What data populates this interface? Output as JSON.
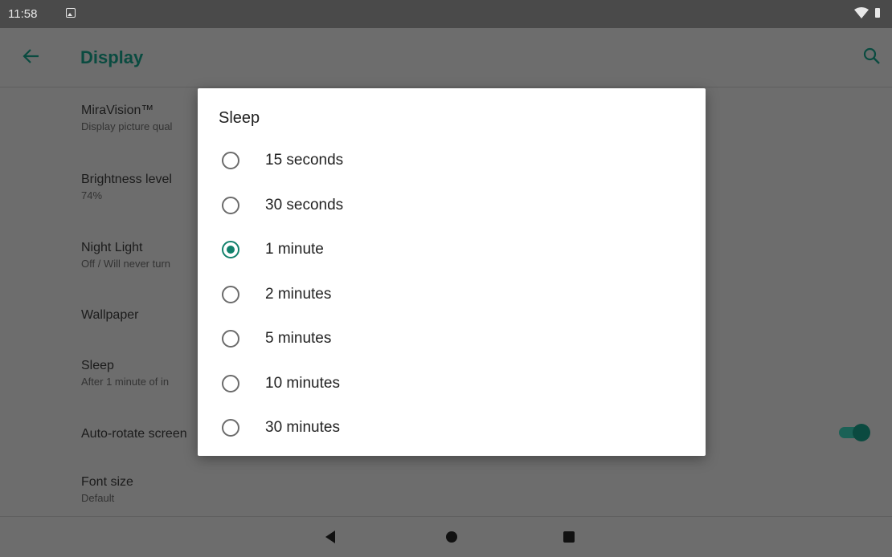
{
  "status_bar": {
    "time": "11:58",
    "icons": [
      "image-notification-icon",
      "wifi-icon",
      "battery-icon"
    ]
  },
  "app_bar": {
    "title": "Display",
    "back_icon": "arrow-left-icon",
    "search_icon": "search-icon"
  },
  "settings": [
    {
      "title": "MiraVision™",
      "summary": "Display picture qual"
    },
    {
      "title": "Brightness level",
      "summary": "74%"
    },
    {
      "title": "Night Light",
      "summary": "Off / Will never turn"
    },
    {
      "title": "Wallpaper",
      "summary": ""
    },
    {
      "title": "Sleep",
      "summary": "After 1 minute of in"
    },
    {
      "title": "Auto-rotate screen",
      "summary": "",
      "toggle_on": true
    },
    {
      "title": "Font size",
      "summary": "Default"
    }
  ],
  "dialog": {
    "title": "Sleep",
    "options": [
      {
        "label": "15 seconds",
        "checked": false
      },
      {
        "label": "30 seconds",
        "checked": false
      },
      {
        "label": "1 minute",
        "checked": true
      },
      {
        "label": "2 minutes",
        "checked": false
      },
      {
        "label": "5 minutes",
        "checked": false
      },
      {
        "label": "10 minutes",
        "checked": false
      },
      {
        "label": "30 minutes",
        "checked": false
      }
    ]
  },
  "nav_bar": {
    "icons": [
      "nav-back-icon",
      "nav-home-icon",
      "nav-recents-icon"
    ]
  },
  "colors": {
    "accent": "#12816c",
    "title": "#0a4b40",
    "scrim_background": "#6d6d6d",
    "status_bar": "#4a4a4a"
  }
}
